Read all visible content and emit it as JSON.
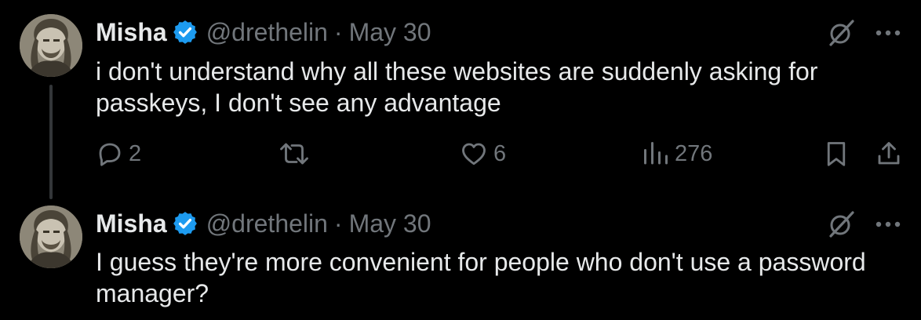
{
  "tweets": [
    {
      "name": "Misha",
      "handle": "@drethelin",
      "separator": "·",
      "date": "May 30",
      "text": "i don't understand why all these websites are suddenly asking for passkeys, I don't see any advantage",
      "actions": {
        "replies": "2",
        "likes": "6",
        "views": "276"
      }
    },
    {
      "name": "Misha",
      "handle": "@drethelin",
      "separator": "·",
      "date": "May 30",
      "text": "I guess they're more convenient for people who don't use a password manager?"
    }
  ],
  "colors": {
    "verified": "#1d9bf0",
    "muted": "#71767b",
    "text": "#e7e9ea",
    "background": "#000000"
  },
  "icons": [
    "verified-badge-icon",
    "grok-icon",
    "more-icon",
    "reply-icon",
    "retweet-icon",
    "like-icon",
    "views-icon",
    "bookmark-icon",
    "share-icon"
  ]
}
